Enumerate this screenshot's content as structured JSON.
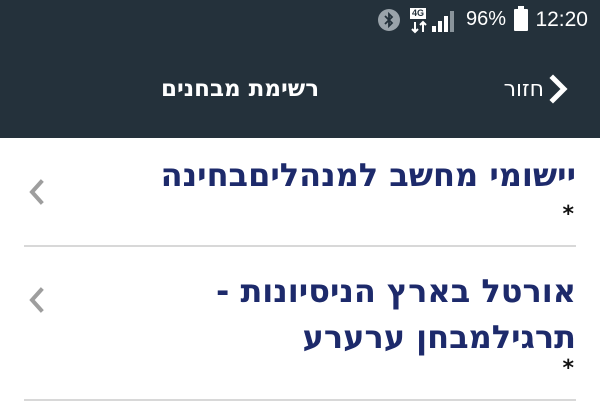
{
  "status_bar": {
    "time": "12:20",
    "battery_percent": "96%",
    "network_type": "4G",
    "icons": [
      "bluetooth-icon",
      "network-4g-icon",
      "signal-icon",
      "battery-icon"
    ]
  },
  "toolbar": {
    "title": "רשימת מבחנים",
    "back_label": "חזור",
    "back_icon": "chevron-right-icon"
  },
  "list": {
    "items": [
      {
        "title": "יישומי מחשב למנהליםבחינה",
        "note": "*",
        "icon": "chevron-left-icon"
      },
      {
        "title_lines": [
          "אורטל בארץ הניסיונות -",
          "תרגילמבחן ערערע"
        ],
        "note": "*",
        "icon": "chevron-left-icon"
      }
    ]
  },
  "colors": {
    "header_bg": "#24313b",
    "title_text": "#1d2a6b",
    "chevron": "#9e9e9e",
    "divider": "#d8d8d8"
  }
}
